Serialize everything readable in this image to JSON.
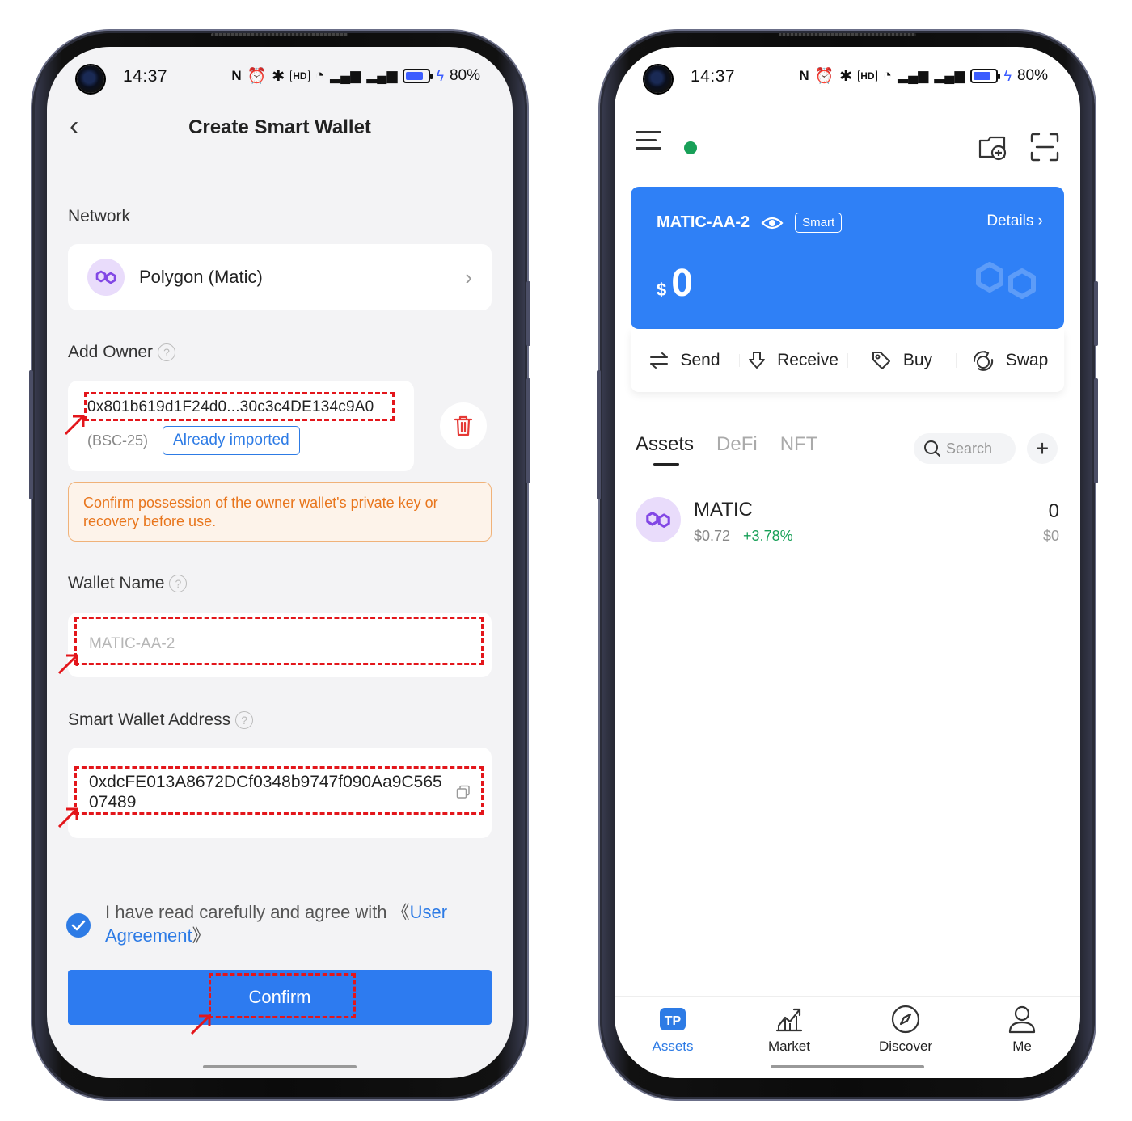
{
  "status": {
    "time": "14:37",
    "battery": "80%"
  },
  "create_wallet": {
    "title": "Create Smart Wallet",
    "network_label": "Network",
    "network_value": "Polygon (Matic)",
    "owner_label": "Add Owner",
    "owner_address": "0x801b619d1F24d0...30c3c4DE134c9A0",
    "owner_tag": "(BSC-25)",
    "owner_status": "Already imported",
    "warning": "Confirm possession of the owner wallet's private key or recovery before use.",
    "wallet_name_label": "Wallet Name",
    "wallet_name_placeholder": "MATIC-AA-2",
    "address_label": "Smart Wallet Address",
    "smart_address": "0xdcFE013A8672DCf0348b9747f090Aa9C56507489",
    "agree_prefix": "I have read carefully and agree with  《",
    "agree_link": "User Agreement",
    "agree_suffix": "》",
    "agreed": true,
    "confirm_label": "Confirm"
  },
  "wallet_home": {
    "wallet_name": "MATIC-AA-2",
    "wallet_badge": "Smart",
    "details_label": "Details ›",
    "currency_symbol": "$",
    "balance": "0",
    "actions": [
      "Send",
      "Receive",
      "Buy",
      "Swap"
    ],
    "tabs": [
      "Assets",
      "DeFi",
      "NFT"
    ],
    "active_tab": "Assets",
    "search_placeholder": "Search",
    "assets": [
      {
        "symbol": "MATIC",
        "price": "$0.72",
        "change": "+3.78%",
        "balance": "0",
        "value": "$0"
      }
    ],
    "bottom_nav": [
      "Assets",
      "Market",
      "Discover",
      "Me"
    ],
    "active_nav": "Assets"
  },
  "colors": {
    "accent": "#2d7bf0",
    "card_blue": "#2f80f6",
    "warning_text": "#e8751c",
    "positive": "#18a058",
    "annotation": "#e3161b",
    "polygon_purple": "#8247e5"
  }
}
